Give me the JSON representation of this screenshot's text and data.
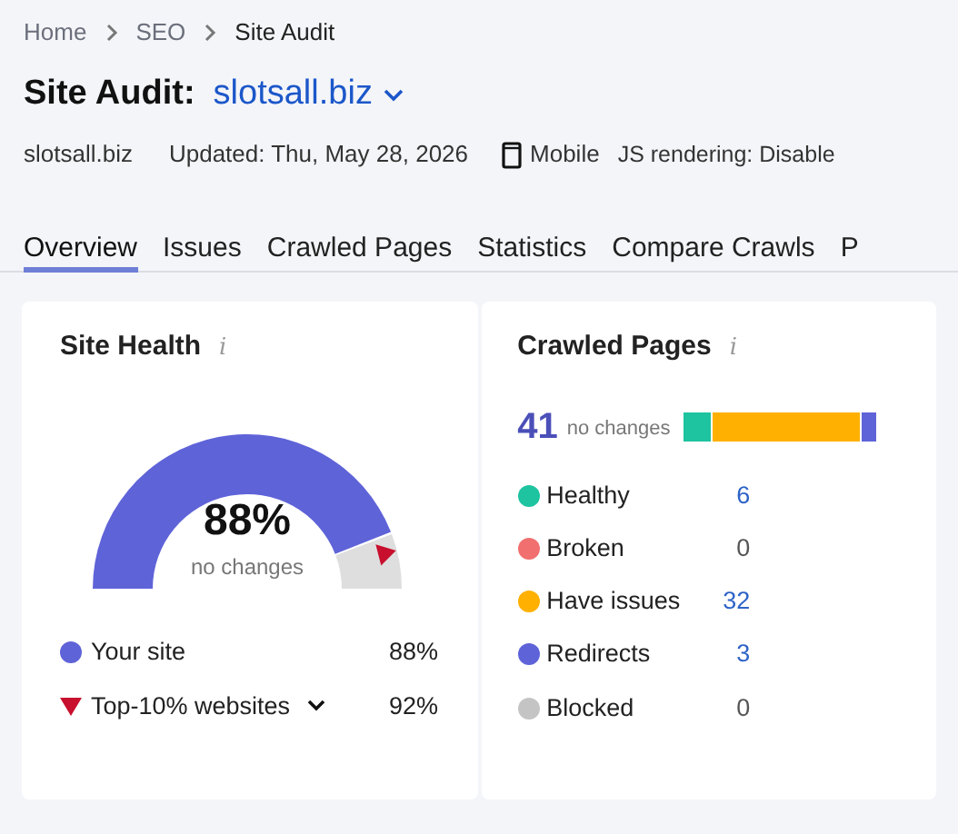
{
  "breadcrumb": [
    "Home",
    "SEO",
    "Site Audit"
  ],
  "title": {
    "label": "Site Audit:",
    "project": "slotsall.biz"
  },
  "meta": {
    "domain": "slotsall.biz",
    "updated": "Updated: Thu, May 28, 2026",
    "device": "Mobile",
    "js": "JS rendering: Disable"
  },
  "tabs": [
    {
      "label": "Overview",
      "selected": true
    },
    {
      "label": "Issues",
      "selected": false
    },
    {
      "label": "Crawled Pages",
      "selected": false
    },
    {
      "label": "Statistics",
      "selected": false
    },
    {
      "label": "Compare Crawls",
      "selected": false
    },
    {
      "label": "P",
      "selected": false
    }
  ],
  "site_health": {
    "title": "Site Health",
    "info": "i",
    "value": "88%",
    "change": "no changes",
    "legend": [
      {
        "kind": "dot",
        "label": "Your site",
        "value": "88%",
        "color": "#5f63d8"
      },
      {
        "kind": "triangle",
        "label": "Top-10% websites",
        "value": "92%",
        "color": "#c8102e"
      }
    ]
  },
  "crawled_pages": {
    "title": "Crawled Pages",
    "info": "i",
    "total": "41",
    "change": "no changes",
    "items": [
      {
        "label": "Healthy",
        "count": "6",
        "color": "#1ec3a0"
      },
      {
        "label": "Broken",
        "count": "0",
        "color": "#f26f6f"
      },
      {
        "label": "Have issues",
        "count": "32",
        "color": "#ffb000"
      },
      {
        "label": "Redirects",
        "count": "3",
        "color": "#5f63d8"
      },
      {
        "label": "Blocked",
        "count": "0",
        "color": "#c4c4c4"
      }
    ]
  }
}
